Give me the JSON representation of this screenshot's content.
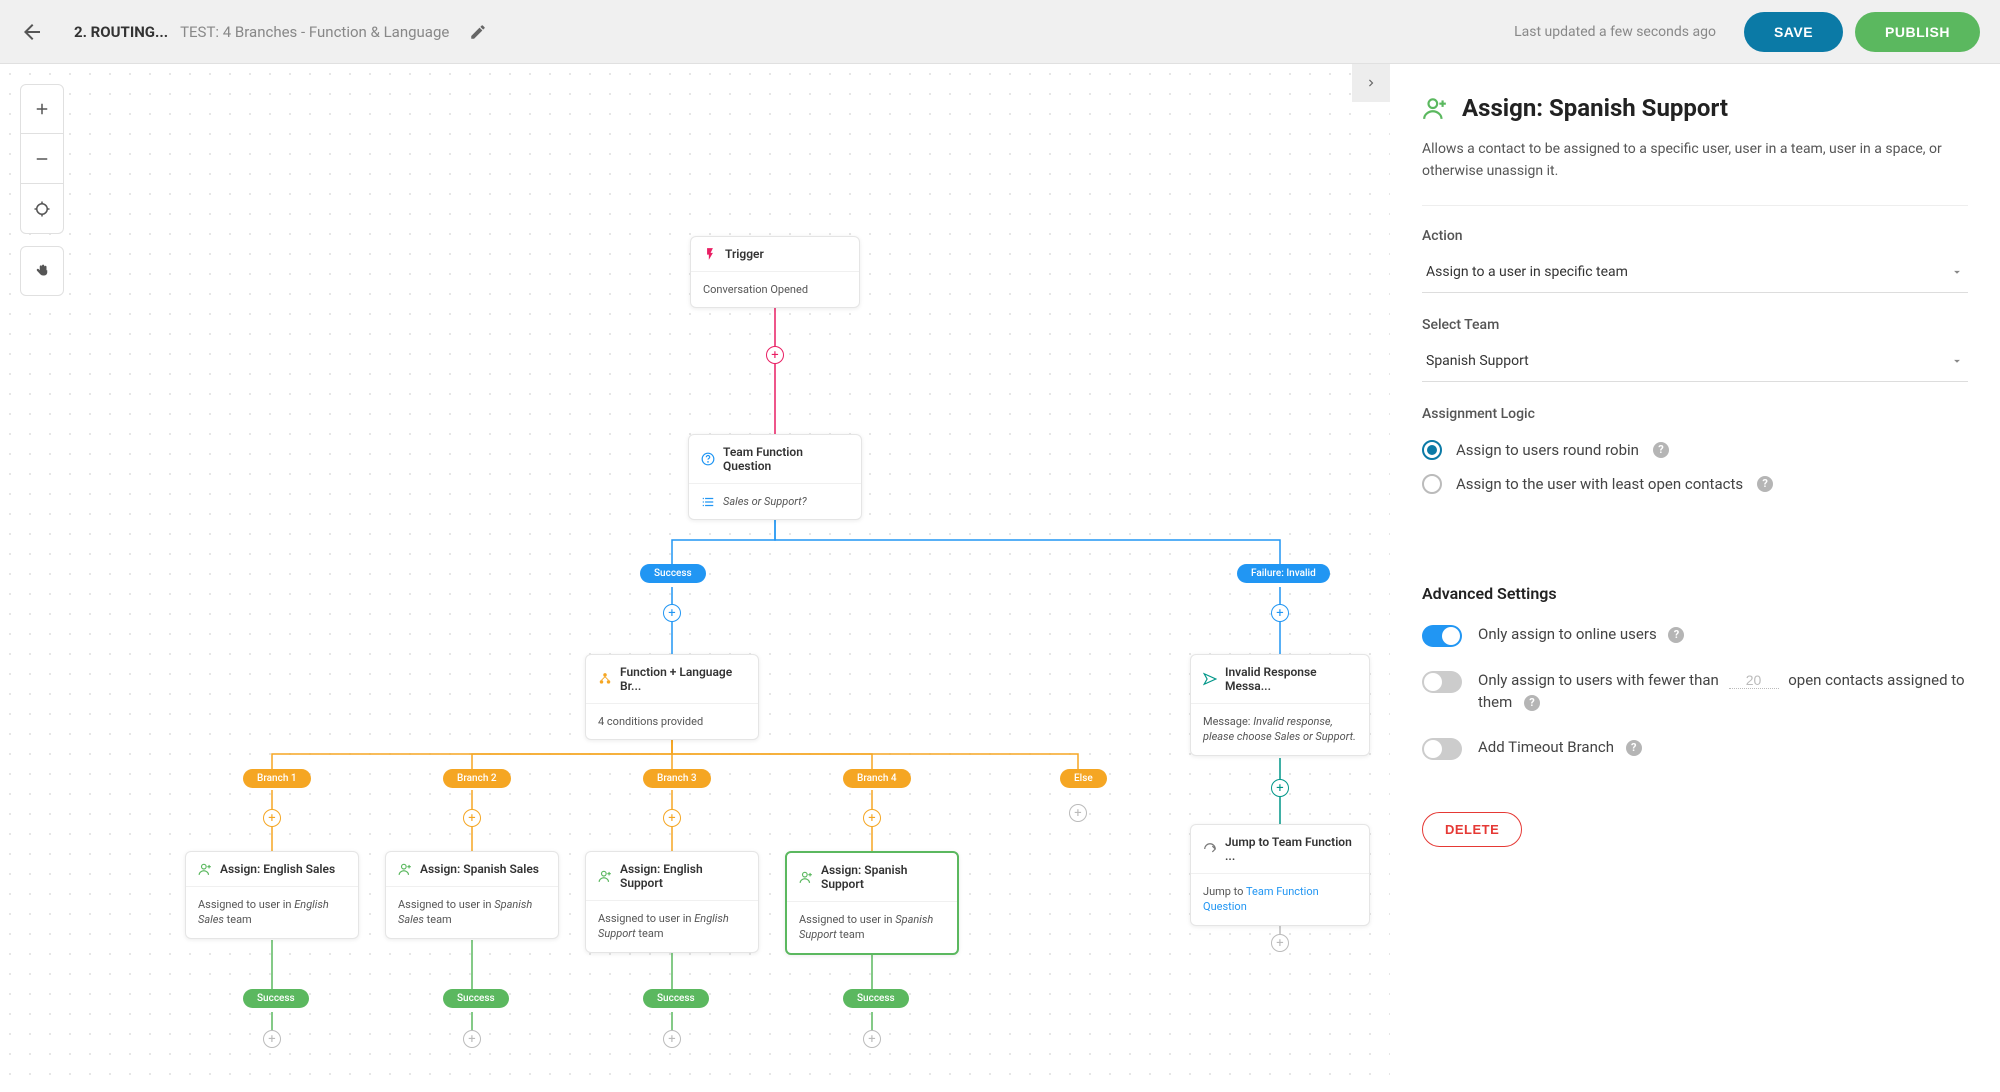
{
  "header": {
    "breadcrumb_main": "2. ROUTING...",
    "breadcrumb_sub": "TEST: 4 Branches - Function & Language",
    "last_updated": "Last updated a few seconds ago",
    "save": "SAVE",
    "publish": "PUBLISH"
  },
  "flow": {
    "trigger": {
      "title": "Trigger",
      "body": "Conversation Opened"
    },
    "question": {
      "title": "Team Function Question",
      "body": "Sales or Support?"
    },
    "success_pill": "Success",
    "failure_pill": "Failure: Invalid",
    "branch_node": {
      "title": "Function + Language Br...",
      "body": "4 conditions provided"
    },
    "invalid_node": {
      "title": "Invalid Response Messa...",
      "body_prefix": "Message: ",
      "body_italic": "Invalid response, please choose Sales or Support."
    },
    "branches": {
      "b1": "Branch 1",
      "b2": "Branch 2",
      "b3": "Branch 3",
      "b4": "Branch 4",
      "else": "Else"
    },
    "assigns": [
      {
        "title": "Assign: English Sales",
        "prefix": "Assigned to user in ",
        "italic": "English Sales",
        "suffix": " team"
      },
      {
        "title": "Assign: Spanish Sales",
        "prefix": "Assigned to user in ",
        "italic": "Spanish Sales",
        "suffix": " team"
      },
      {
        "title": "Assign: English Support",
        "prefix": "Assigned to user in ",
        "italic": "English Support",
        "suffix": " team"
      },
      {
        "title": "Assign: Spanish Support",
        "prefix": "Assigned to user in ",
        "italic": "Spanish Support",
        "suffix": " team"
      }
    ],
    "success": "Success",
    "jump": {
      "title": "Jump to Team Function ...",
      "prefix": "Jump to ",
      "link": "Team Function Question"
    }
  },
  "sidebar": {
    "title": "Assign: Spanish Support",
    "desc": "Allows a contact to be assigned to a specific user, user in a team, user in a space, or otherwise unassign it.",
    "action_label": "Action",
    "action_value": "Assign to a user in specific team",
    "team_label": "Select Team",
    "team_value": "Spanish Support",
    "logic_label": "Assignment Logic",
    "radio1": "Assign to users round robin",
    "radio2": "Assign to the user with least open contacts",
    "advanced": "Advanced Settings",
    "toggle1": "Only assign to online users",
    "toggle2_pre": "Only assign to users with fewer than",
    "toggle2_val": "20",
    "toggle2_post": "open contacts assigned to them",
    "toggle3": "Add Timeout Branch",
    "delete": "DELETE"
  }
}
